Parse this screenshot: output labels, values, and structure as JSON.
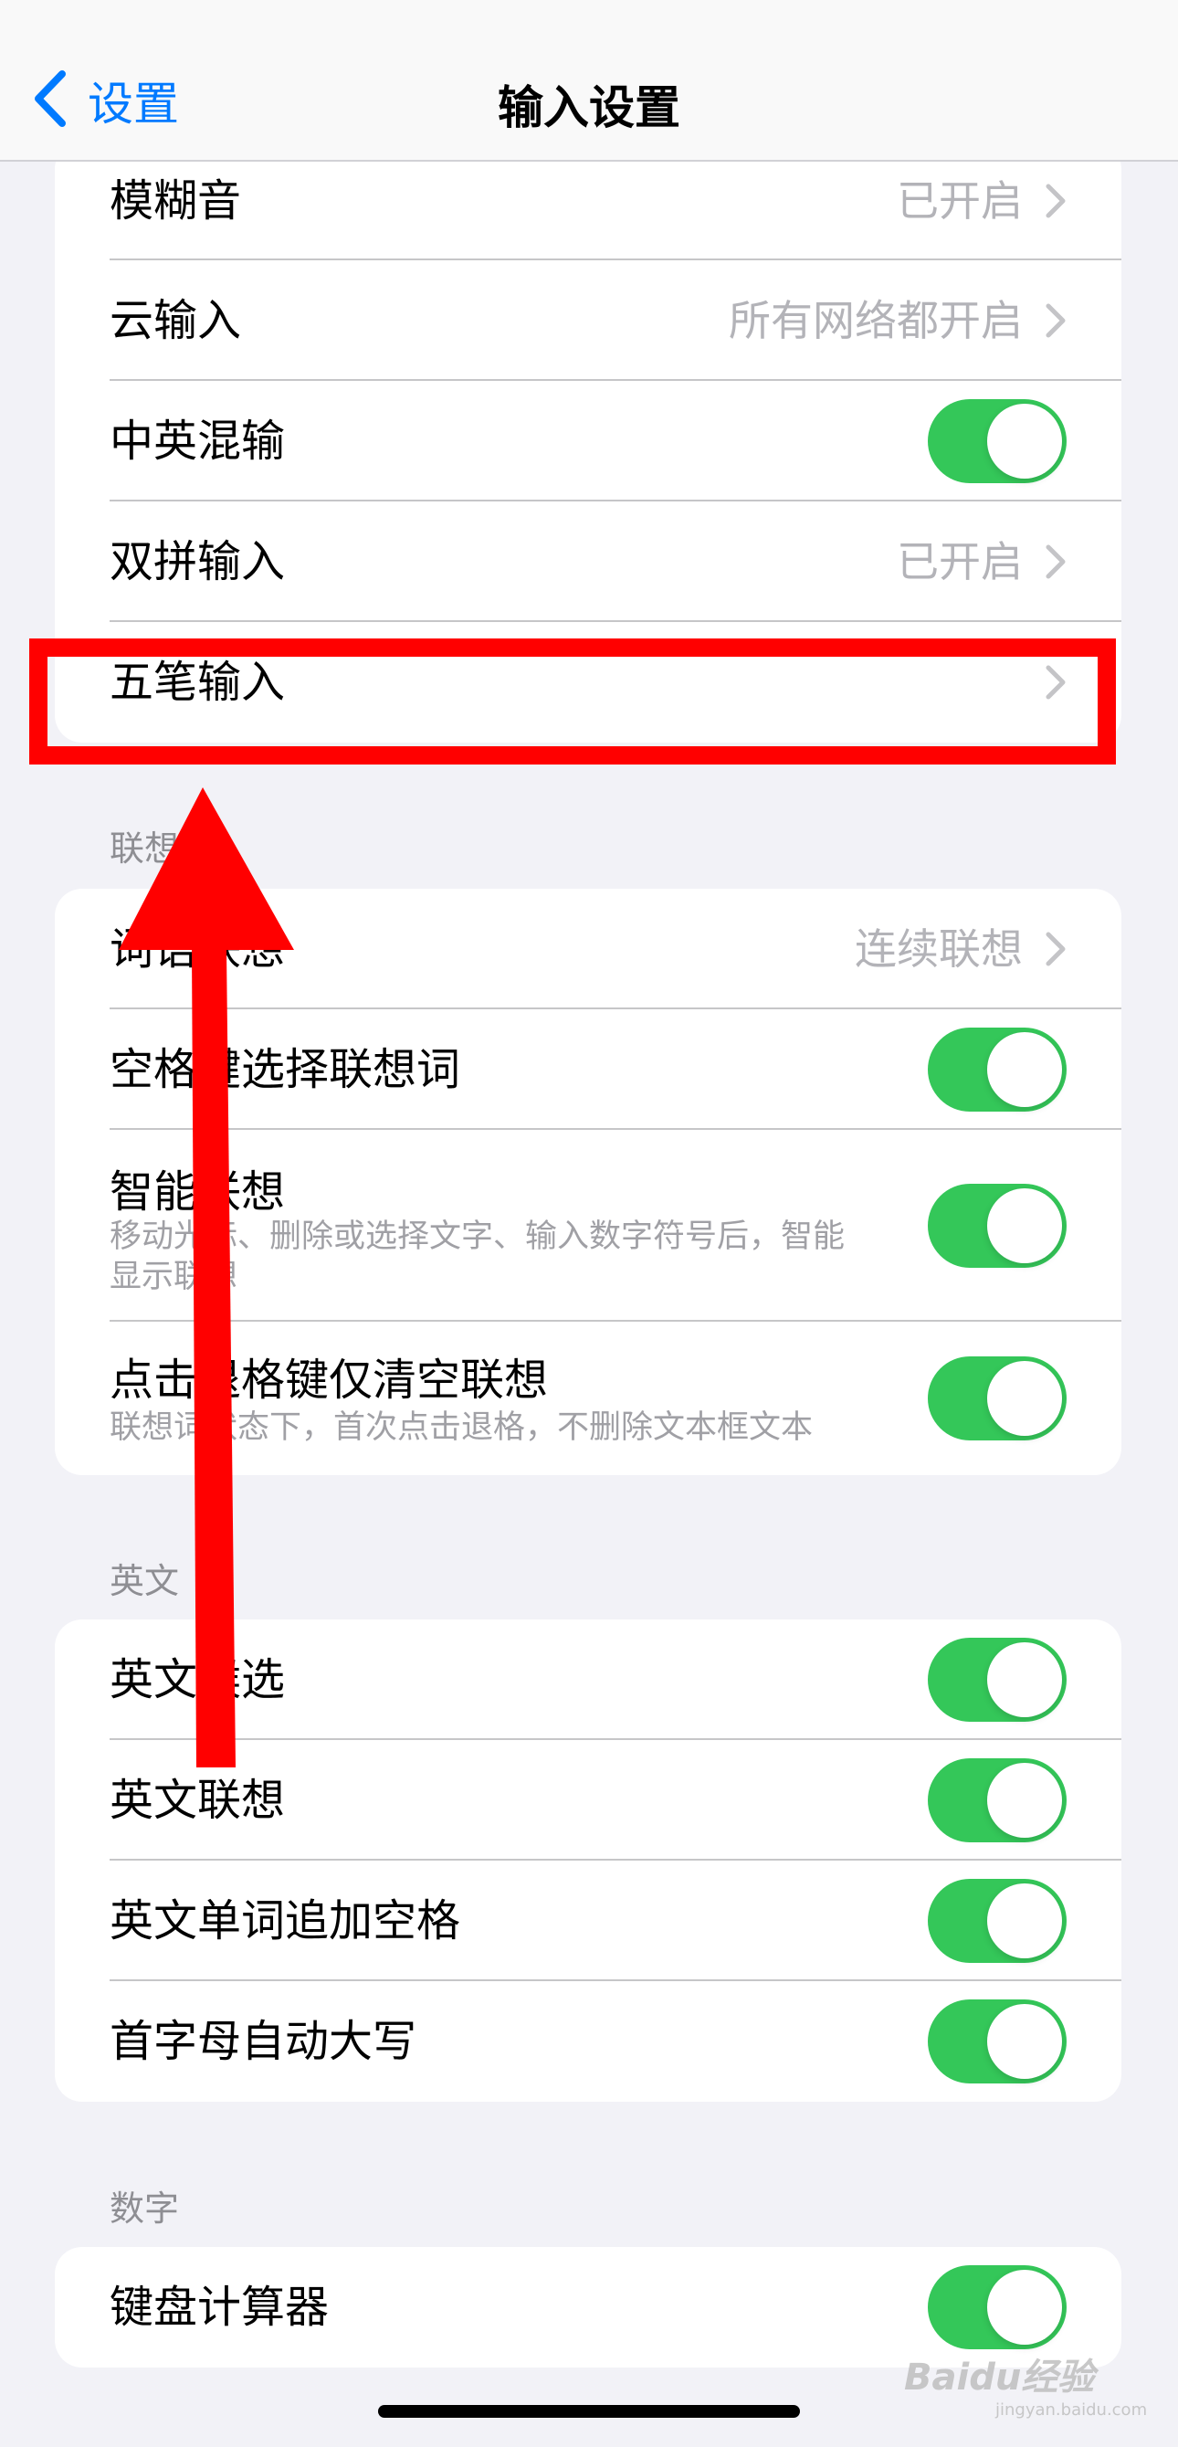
{
  "nav": {
    "back_label": "设置",
    "title": "输入设置"
  },
  "group1": [
    {
      "label": "模糊音",
      "value": "已开启"
    },
    {
      "label": "云输入",
      "value": "所有网络都开启"
    },
    {
      "label": "中英混输"
    },
    {
      "label": "双拼输入",
      "value": "已开启"
    },
    {
      "label": "五笔输入"
    }
  ],
  "sections": {
    "lianxiang": "联想",
    "english": "英文",
    "numbers": "数字"
  },
  "group2": [
    {
      "label": "词语联想",
      "value": "连续联想"
    },
    {
      "label": "空格键选择联想词"
    },
    {
      "label": "智能联想",
      "sub": "移动光标、删除或选择文字、输入数字符号后，智能显示联想"
    },
    {
      "label": "点击退格键仅清空联想",
      "sub": "联想词状态下，首次点击退格，不删除文本框文本"
    }
  ],
  "group3": [
    {
      "label": "英文候选"
    },
    {
      "label": "英文联想"
    },
    {
      "label": "英文单词追加空格"
    },
    {
      "label": "首字母自动大写"
    }
  ],
  "group4": [
    {
      "label": "键盘计算器"
    }
  ],
  "toggles": {
    "zhongying_hunshu": true,
    "kongge_xuanze": true,
    "zhineng_lianxiang": true,
    "tuige_qingkong": true,
    "yingwen_houxuan": true,
    "yingwen_lianxiang": true,
    "yingwen_kongge": true,
    "shouzimu_daxie": true,
    "jianpan_jisuanqi": true
  },
  "watermark": {
    "text": "Baidu经验",
    "sub": "jingyan.baidu.com"
  },
  "colors": {
    "accent": "#007aff",
    "toggle_on": "#34c759",
    "annotation": "#ff0000"
  },
  "icons": [
    "chevron-left-icon",
    "chevron-right-icon",
    "annotation-arrow-icon"
  ]
}
